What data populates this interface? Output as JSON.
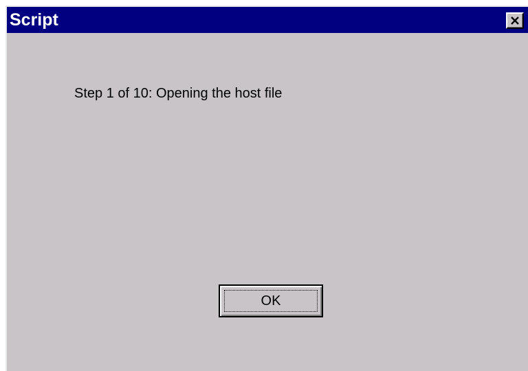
{
  "window": {
    "title": "Script"
  },
  "dialog": {
    "message": "Step 1 of 10: Opening the host file",
    "ok_label": "OK"
  },
  "icons": {
    "close": "close-icon"
  },
  "colors": {
    "titlebar": "#000080",
    "face": "#c8c4c8"
  }
}
